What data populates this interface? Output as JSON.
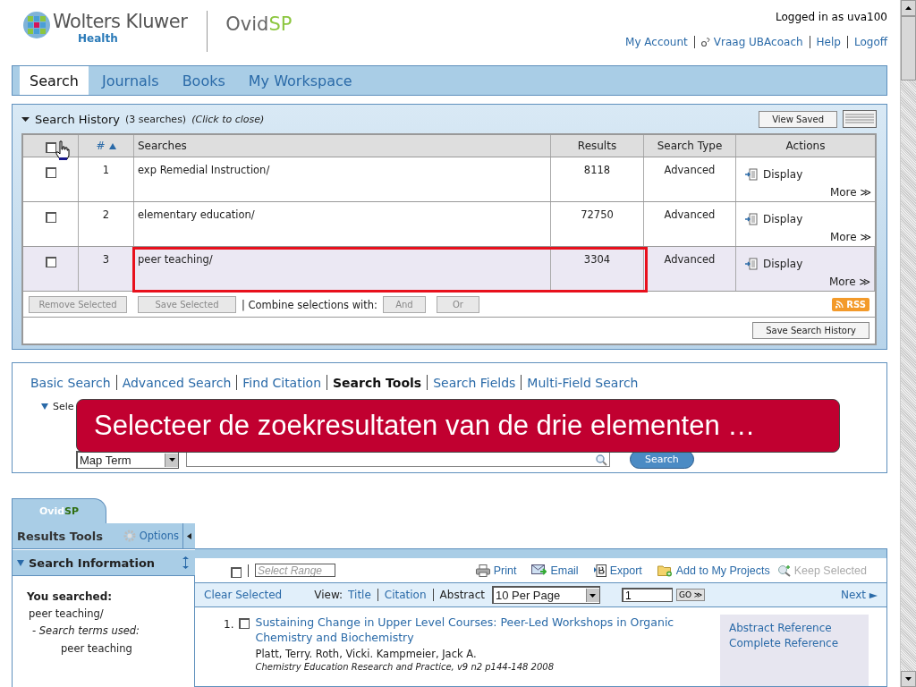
{
  "header": {
    "brand": "Wolters Kluwer",
    "brand_sub": "Health",
    "product": "Ovid",
    "product_suffix": "SP",
    "logged_in": "Logged in as uva100",
    "links": [
      {
        "label": "My Account",
        "kind": "plain"
      },
      {
        "label": "Vraag UBAcoach",
        "kind": "help"
      },
      {
        "label": "Help",
        "kind": "plain"
      },
      {
        "label": "Logoff",
        "kind": "plain"
      }
    ]
  },
  "tabs": [
    {
      "label": "Search",
      "selected": true
    },
    {
      "label": "Journals",
      "selected": false
    },
    {
      "label": "Books",
      "selected": false
    },
    {
      "label": "My Workspace",
      "selected": false
    }
  ],
  "search_history": {
    "title": "Search History",
    "count": "(3 searches)",
    "hint": "(Click to close)",
    "expanded": true,
    "view_saved": "View Saved",
    "select_all_checked": false,
    "columns": [
      "#",
      "Searches",
      "Results",
      "Search Type",
      "Actions"
    ],
    "rows": [
      {
        "number": "1",
        "search": "exp Remedial Instruction/",
        "results": "8118",
        "type": "Advanced",
        "display": "Display",
        "more": "More ≫",
        "checked": false,
        "selected": false,
        "highlighted": false
      },
      {
        "number": "2",
        "search": "elementary education/",
        "results": "72750",
        "type": "Advanced",
        "display": "Display",
        "more": "More ≫",
        "checked": false,
        "selected": false,
        "highlighted": false
      },
      {
        "number": "3",
        "search": "peer teaching/",
        "results": "3304",
        "type": "Advanced",
        "display": "Display",
        "more": "More ≫",
        "checked": false,
        "selected": true,
        "highlighted": true
      }
    ],
    "buttons": [
      "Remove Selected",
      "Save Selected"
    ],
    "combine_label": "| Combine selections with:",
    "combine_buttons": [
      "And",
      "Or"
    ],
    "rss": "RSS",
    "save_history": "Save Search History"
  },
  "search_tools": {
    "links": [
      {
        "label": "Basic Search",
        "selected": false
      },
      {
        "label": "Advanced Search",
        "selected": false
      },
      {
        "label": "Find Citation",
        "selected": false
      },
      {
        "label": "Search Tools",
        "selected": true
      },
      {
        "label": "Search Fields",
        "selected": false
      },
      {
        "label": "Multi-Field Search",
        "selected": false
      }
    ],
    "section_label": "Sele",
    "field_select": "Map Term",
    "search_button": "Search"
  },
  "caption": "Selecteer de zoekresultaten van de drie elementen …",
  "results": {
    "tab_product": "Ovid",
    "tab_suffix": "SP",
    "tools_title": "Results Tools",
    "options": "Options",
    "search_info": "Search Information",
    "you_searched": "You searched:",
    "query": "peer teaching/",
    "terms_label": "- Search terms used:",
    "terms": [
      "peer teaching"
    ],
    "select_all_checked": false,
    "select_range_placeholder": "Select Range",
    "actions": [
      {
        "label": "Print",
        "kind": "print",
        "disabled": false
      },
      {
        "label": "Email",
        "kind": "email",
        "disabled": false
      },
      {
        "label": "Export",
        "kind": "export",
        "disabled": false
      },
      {
        "label": "Add to My Projects",
        "kind": "projects",
        "disabled": false
      },
      {
        "label": "Keep Selected",
        "kind": "keep",
        "disabled": true
      }
    ],
    "clear_selected": "Clear Selected",
    "view_label": "View:",
    "views": [
      {
        "label": "Title",
        "selected": false
      },
      {
        "label": "Citation",
        "selected": false
      },
      {
        "label": "Abstract",
        "selected": true
      }
    ],
    "per_page": "10 Per Page",
    "page": "1",
    "go": "GO ≫",
    "next": "Next ►",
    "items": [
      {
        "number": "1.",
        "title": "Sustaining Change in Upper Level Courses: Peer-Led Workshops in Organic Chemistry and Biochemistry",
        "authors": "Platt, Terry. Roth, Vicki. Kampmeier, Jack A.",
        "source": "Chemistry Education Research and Practice, v9 n2 p144-148 2008",
        "checked": false,
        "links": [
          "Abstract Reference",
          "Complete Reference"
        ]
      }
    ]
  }
}
